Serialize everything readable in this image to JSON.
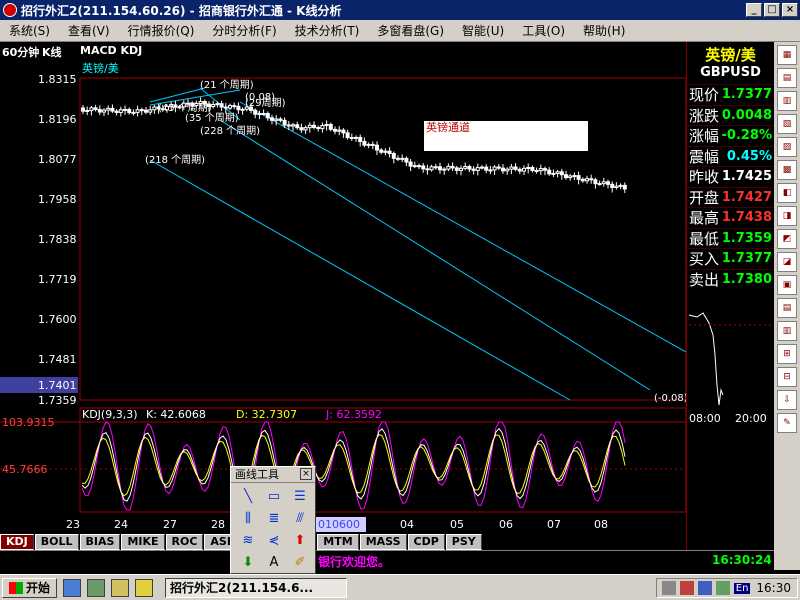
{
  "window": {
    "title": "招行外汇2(211.154.60.26) - 招商银行外汇通 - K线分析",
    "buttons": [
      "_",
      "□",
      "×"
    ]
  },
  "menu": [
    "系统(S)",
    "查看(V)",
    "行情报价(Q)",
    "分时分析(F)",
    "技术分析(T)",
    "多窗看盘(G)",
    "智能(U)",
    "工具(O)",
    "帮助(H)"
  ],
  "chart_head": {
    "period": "60分钟",
    "type": "K线",
    "indicators": "MACD KDJ"
  },
  "symbol_label": "英镑/美",
  "channel_label": "英镑通道",
  "price_axis": [
    "1.8315",
    "1.8196",
    "1.8077",
    "1.7958",
    "1.7838",
    "1.7719",
    "1.7600",
    "1.7481",
    "1.7401",
    "1.7359"
  ],
  "cycle_labels": [
    "(21 个周期)",
    "(45 个周期)",
    "(35 个周期)",
    "(228 个周期)",
    "(218 个周期)",
    "(29周期)",
    "(0.08)",
    "(-0.08)"
  ],
  "kdj": {
    "header_name": "KDJ(9,3,3)",
    "k": "K: 42.6068",
    "d": "D: 32.7307",
    "j": "J: 62.3592",
    "axis_top": "103.9315",
    "axis_mid": "45.7666"
  },
  "date_axis": [
    "23",
    "24",
    "27",
    "28",
    "04",
    "05",
    "06",
    "07",
    "08"
  ],
  "date_box": "010600",
  "tabs": [
    "KDJ",
    "BOLL",
    "BIAS",
    "MIKE",
    "ROC",
    "ASI",
    "OSC",
    "VMA",
    "MTM",
    "MASS",
    "CDP",
    "PSY"
  ],
  "draw_toolbox_title": "画线工具",
  "right_panel": {
    "name": "英镑/美",
    "code": "GBPUSD",
    "rows": [
      {
        "label": "现价",
        "value": "1.7377",
        "color": "#00ff00"
      },
      {
        "label": "涨跌",
        "value": "0.0048",
        "color": "#00ff00"
      },
      {
        "label": "涨幅",
        "value": "-0.28%",
        "color": "#00ff00"
      },
      {
        "label": "震幅",
        "value": "0.45%",
        "color": "#00ffff"
      },
      {
        "label": "昨收",
        "value": "1.7425",
        "color": "#ffffff"
      },
      {
        "label": "开盘",
        "value": "1.7427",
        "color": "#ff3030"
      },
      {
        "label": "最高",
        "value": "1.7438",
        "color": "#ff3030"
      },
      {
        "label": "最低",
        "value": "1.7359",
        "color": "#00ff00"
      },
      {
        "label": "买入",
        "value": "1.7377",
        "color": "#00ff00"
      },
      {
        "label": "卖出",
        "value": "1.7380",
        "color": "#00ff00"
      }
    ],
    "mini_time_start": "08:00",
    "mini_time_end": "20:00"
  },
  "status": {
    "marquee": "银行欢迎您。",
    "clock": "16:30:24"
  },
  "taskbar": {
    "start": "开始",
    "task": "招行外汇2(211.154.6...",
    "tray_lang": "En",
    "tray_time": "16:30"
  }
}
